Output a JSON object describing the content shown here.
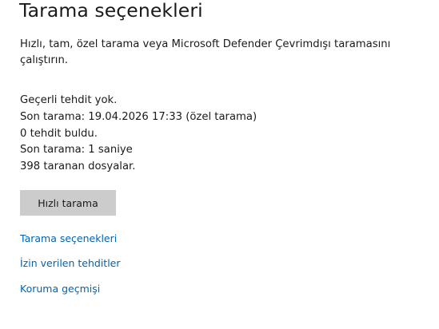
{
  "header": {
    "title": "Tarama seçenekleri"
  },
  "description": "Hızlı, tam, özel tarama veya Microsoft Defender Çevrimdışı taramasını çalıştırın.",
  "status": {
    "threat_status": "Geçerli tehdit yok.",
    "last_scan": "Son tarama: 19.04.2026 17:33 (özel tarama)",
    "threats_found": "0 tehdit buldu.",
    "scan_duration": "Son tarama: 1 saniye",
    "files_scanned": "398 taranan dosyalar."
  },
  "actions": {
    "quick_scan_label": "Hızlı tarama"
  },
  "links": {
    "scan_options": "Tarama seçenekleri",
    "allowed_threats": "İzin verilen tehditler",
    "protection_history": "Koruma geçmişi"
  },
  "colors": {
    "link": "#0063b1",
    "button_bg": "#cccccc",
    "text": "#1a1a1a"
  }
}
